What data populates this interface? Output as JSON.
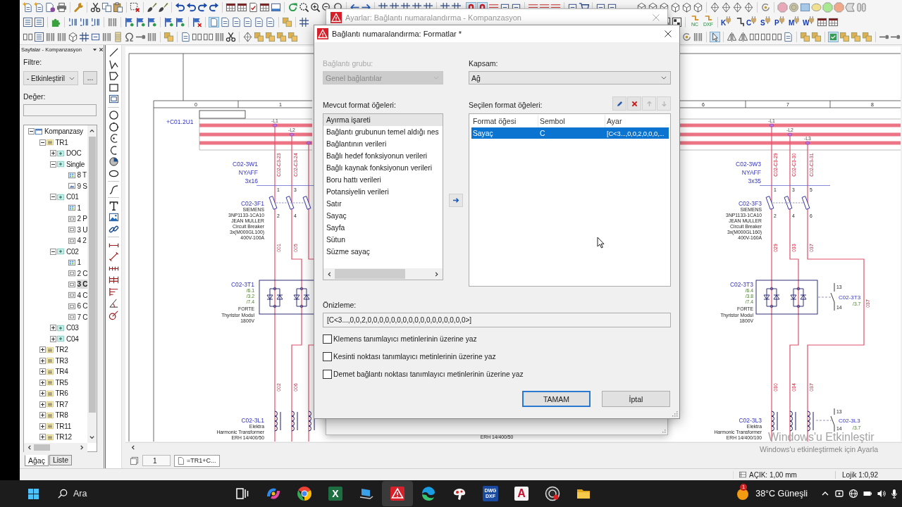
{
  "toolbar": {
    "export_labels": [
      "NC",
      "DXF"
    ],
    "plug_letters": [
      "K",
      "C",
      "S",
      "P",
      "M",
      "W"
    ]
  },
  "pages_panel": {
    "title": "Sayfalar - Kompanzasyon",
    "filter_label": "Filtre:",
    "filter_value": "- Etkinleştiril",
    "more_button": "...",
    "value_label": "Değer:",
    "tree": [
      {
        "label": "Kompanzasy",
        "kind": "project",
        "expanded": true,
        "selected": false,
        "children": [
          {
            "label": "TR1",
            "kind": "structure",
            "expanded": true,
            "selected": false,
            "children": [
              {
                "label": "DOC",
                "kind": "group",
                "expanded": false,
                "selected": false
              },
              {
                "label": "Single",
                "kind": "group",
                "expanded": true,
                "selected": false,
                "children": [
                  {
                    "label": "8 T",
                    "kind": "overview",
                    "selected": false
                  },
                  {
                    "label": "9 S",
                    "kind": "graphic",
                    "selected": false
                  }
                ]
              },
              {
                "label": "C01",
                "kind": "group",
                "expanded": true,
                "selected": false,
                "children": [
                  {
                    "label": "1",
                    "kind": "overview",
                    "selected": false
                  },
                  {
                    "label": "2 P",
                    "kind": "schematic",
                    "selected": false
                  },
                  {
                    "label": "3 U",
                    "kind": "schematic",
                    "selected": false
                  },
                  {
                    "label": "4 2",
                    "kind": "schematic",
                    "selected": false
                  }
                ]
              },
              {
                "label": "C02",
                "kind": "group",
                "expanded": true,
                "selected": false,
                "children": [
                  {
                    "label": "1",
                    "kind": "overview",
                    "selected": false
                  },
                  {
                    "label": "2 C",
                    "kind": "schematic",
                    "selected": false
                  },
                  {
                    "label": "3 C",
                    "kind": "schematic",
                    "selected": true
                  },
                  {
                    "label": "4 C",
                    "kind": "schematic",
                    "selected": false
                  },
                  {
                    "label": "6 C",
                    "kind": "schematic",
                    "selected": false
                  },
                  {
                    "label": "7 C",
                    "kind": "schematic",
                    "selected": false
                  }
                ]
              },
              {
                "label": "C03",
                "kind": "group",
                "expanded": false,
                "selected": false
              },
              {
                "label": "C04",
                "kind": "group",
                "expanded": false,
                "selected": false
              }
            ]
          },
          {
            "label": "TR2",
            "kind": "structure",
            "expanded": false,
            "selected": false
          },
          {
            "label": "TR3",
            "kind": "structure",
            "expanded": false,
            "selected": false
          },
          {
            "label": "TR4",
            "kind": "structure",
            "expanded": false,
            "selected": false
          },
          {
            "label": "TR5",
            "kind": "structure",
            "expanded": false,
            "selected": false
          },
          {
            "label": "TR6",
            "kind": "structure",
            "expanded": false,
            "selected": false
          },
          {
            "label": "TR7",
            "kind": "structure",
            "expanded": false,
            "selected": false
          },
          {
            "label": "TR8",
            "kind": "structure",
            "expanded": false,
            "selected": false
          },
          {
            "label": "TR11",
            "kind": "structure",
            "expanded": false,
            "selected": false
          },
          {
            "label": "TR12",
            "kind": "structure",
            "expanded": false,
            "selected": false
          }
        ]
      }
    ],
    "tabs": [
      {
        "label": "Ağaç",
        "selected": true
      },
      {
        "label": "Liste",
        "selected": false
      }
    ]
  },
  "schematic": {
    "column_numbers": [
      "0",
      "1",
      "6",
      "7",
      "8"
    ],
    "location_tag": "+C01.2U1",
    "circuits": [
      {
        "phases": [
          "-L1",
          "-L2"
        ],
        "wire_labels": [
          "C02-C3-23",
          "C02-C3-24"
        ],
        "cable": {
          "tag": "C02-3W1",
          "type": "NYAFF",
          "size": "3x16"
        },
        "terminals_in": [
          "1",
          "3"
        ],
        "terminals_out": [
          "2",
          "4"
        ],
        "breaker": {
          "tag": "C02-3F1",
          "details": [
            "SIEMENS",
            "3NP1133-1CA10",
            "JEAN MULLER",
            "Circuit Breaker",
            "3x(M000GL100)",
            "400V-100A"
          ]
        },
        "wire_numbers_upper": [
          "001",
          "005"
        ],
        "thyristor": {
          "tag": "C02-3T1",
          "refs": [
            "/6.1",
            "/3.2",
            "/7.4"
          ],
          "details": [
            "FORTE",
            "Thyristor Modul",
            "1800V"
          ]
        },
        "wire_numbers_lower": [
          "002",
          "006"
        ],
        "reactor": {
          "tag": "C02-3L1",
          "details": [
            "Elektra",
            "Harmonic Transformer",
            "ERH 14/400/50"
          ]
        }
      },
      {
        "phases": [
          "-L1",
          "-L2",
          "-L3"
        ],
        "wire_labels": [
          "C02-C3-29",
          "C02-C3-30",
          "C02-C3-31"
        ],
        "cable": {
          "tag": "C02-3W3",
          "type": "NYAFF",
          "size": "3x35"
        },
        "terminals_in": [
          "1",
          "3",
          "5"
        ],
        "terminals_out": [
          "2",
          "4",
          "6"
        ],
        "breaker": {
          "tag": "C02-3F3",
          "details": [
            "SIEMENS",
            "3NP1133-1CA10",
            "JEAN MULLER",
            "Circuit Breaker",
            "3x(M000GL160)",
            "400V-160A"
          ]
        },
        "wire_numbers_upper": [
          "029",
          "033",
          "037"
        ],
        "bypass_wire_number": "037",
        "thyristor": {
          "tag": "C02-3T3",
          "refs": [
            "/6.4",
            "/3.8",
            "/7.4"
          ],
          "details": [
            "FORTE",
            "Thyristor Modul",
            "1800V"
          ]
        },
        "wire_numbers_lower": [
          "030",
          "034",
          "037"
        ],
        "reactor": {
          "tag": "C02-3L3",
          "details": [
            "Elektra",
            "Harmonic Transformer",
            "ERH 14/400/100"
          ]
        },
        "auxiliary_contacts": [
          {
            "terminals": [
              "13",
              "14"
            ],
            "tag": "C02-3T3",
            "ref": "/3.7"
          },
          {
            "terminals": [
              "13",
              "14"
            ],
            "tag": "C02-3L3",
            "ref": "/3.7"
          }
        ]
      }
    ],
    "other_labels": [
      "ERH 14/400/50"
    ]
  },
  "page_bar": {
    "page_number": "1",
    "page_tab": "=TR1+C..."
  },
  "status_bar": {
    "items": [
      "AÇIK: 1,00 mm",
      "Lojik 1:0,92"
    ]
  },
  "background_dialog": {
    "title": "Ayarlar: Bağlantı numaralandırma - Kompanzasyon"
  },
  "dialog": {
    "title": "Bağlantı numaralandırma: Formatlar *",
    "group": {
      "label": "Bağlantı grubu:",
      "value": "Genel bağlantılar",
      "disabled": true
    },
    "scope": {
      "label": "Kapsam:",
      "value": "Ağ",
      "disabled": false
    },
    "available": {
      "label": "Mevcut format öğeleri:",
      "items": [
        {
          "label": "Ayırma işareti",
          "selected": true
        },
        {
          "label": "Bağlantı grubunun temel aldığı nes",
          "selected": false
        },
        {
          "label": "Bağlantının verileri",
          "selected": false
        },
        {
          "label": "Bağlı hedef fonksiyonun verileri",
          "selected": false
        },
        {
          "label": "Bağlı kaynak fonksiyonun verileri",
          "selected": false
        },
        {
          "label": "Boru hattı verileri",
          "selected": false
        },
        {
          "label": "Potansiyelin verileri",
          "selected": false
        },
        {
          "label": "Satır",
          "selected": false
        },
        {
          "label": "Sayaç",
          "selected": false
        },
        {
          "label": "Sayfa",
          "selected": false
        },
        {
          "label": "Sütun",
          "selected": false
        },
        {
          "label": "Süzme sayaç",
          "selected": false
        }
      ]
    },
    "chosen": {
      "label": "Seçilen format öğeleri:",
      "tools": [
        {
          "kind": "edit",
          "disabled": false
        },
        {
          "kind": "delete",
          "disabled": false
        },
        {
          "kind": "up",
          "disabled": true
        },
        {
          "kind": "down",
          "disabled": true
        }
      ],
      "columns": [
        "Format öğesi",
        "Sembol",
        "Ayar"
      ],
      "rows": [
        {
          "cells": [
            "Sayaç",
            "C",
            "[C<3...,0,0,2,0,0,0,..."
          ],
          "selected": true
        }
      ]
    },
    "preview": {
      "label": "Önizleme:",
      "value": "[C<3...,0,0,2,0,0,0,0,0,0,0,0,0,0,0,0,0,0,0,0,0>]"
    },
    "options": [
      {
        "label": "Klemens tanımlayıcı metinlerinin üzerine yaz",
        "checked": false
      },
      {
        "label": "Kesinti noktası tanımlayıcı metinlerinin üzerine yaz",
        "checked": false
      },
      {
        "label": "Demet bağlantı noktası tanımlayıcı metinlerinin üzerine yaz",
        "checked": false
      }
    ],
    "buttons": [
      {
        "label": "TAMAM",
        "default": true
      },
      {
        "label": "İptal",
        "default": false
      }
    ]
  },
  "watermark": {
    "title": "Windows'u Etkinleştir",
    "hint": "Windows'u etkinleştirmek için Ayarla"
  },
  "taskbar": {
    "search": {
      "placeholder": "Ara"
    },
    "apps": [
      {
        "kind": "task_view",
        "selected": false
      },
      {
        "kind": "swirl",
        "selected": false
      },
      {
        "kind": "browser",
        "selected": false
      },
      {
        "kind": "letter_tile",
        "letter": "X",
        "color": "#1d6f42",
        "selected": false
      },
      {
        "kind": "monitor",
        "selected": false
      },
      {
        "kind": "warning_tile",
        "selected": true
      },
      {
        "kind": "wave",
        "selected": false
      },
      {
        "kind": "blob",
        "selected": false
      },
      {
        "kind": "text_tile",
        "lines": [
          "DWG",
          "DXF"
        ],
        "selected": false
      },
      {
        "kind": "light_letter_tile",
        "letter": "A",
        "color": "#c8102e",
        "selected": false
      },
      {
        "kind": "record",
        "selected": false
      },
      {
        "kind": "folder",
        "selected": false
      }
    ],
    "weather": {
      "badge": "1",
      "text": "38°C Güneşli"
    }
  }
}
